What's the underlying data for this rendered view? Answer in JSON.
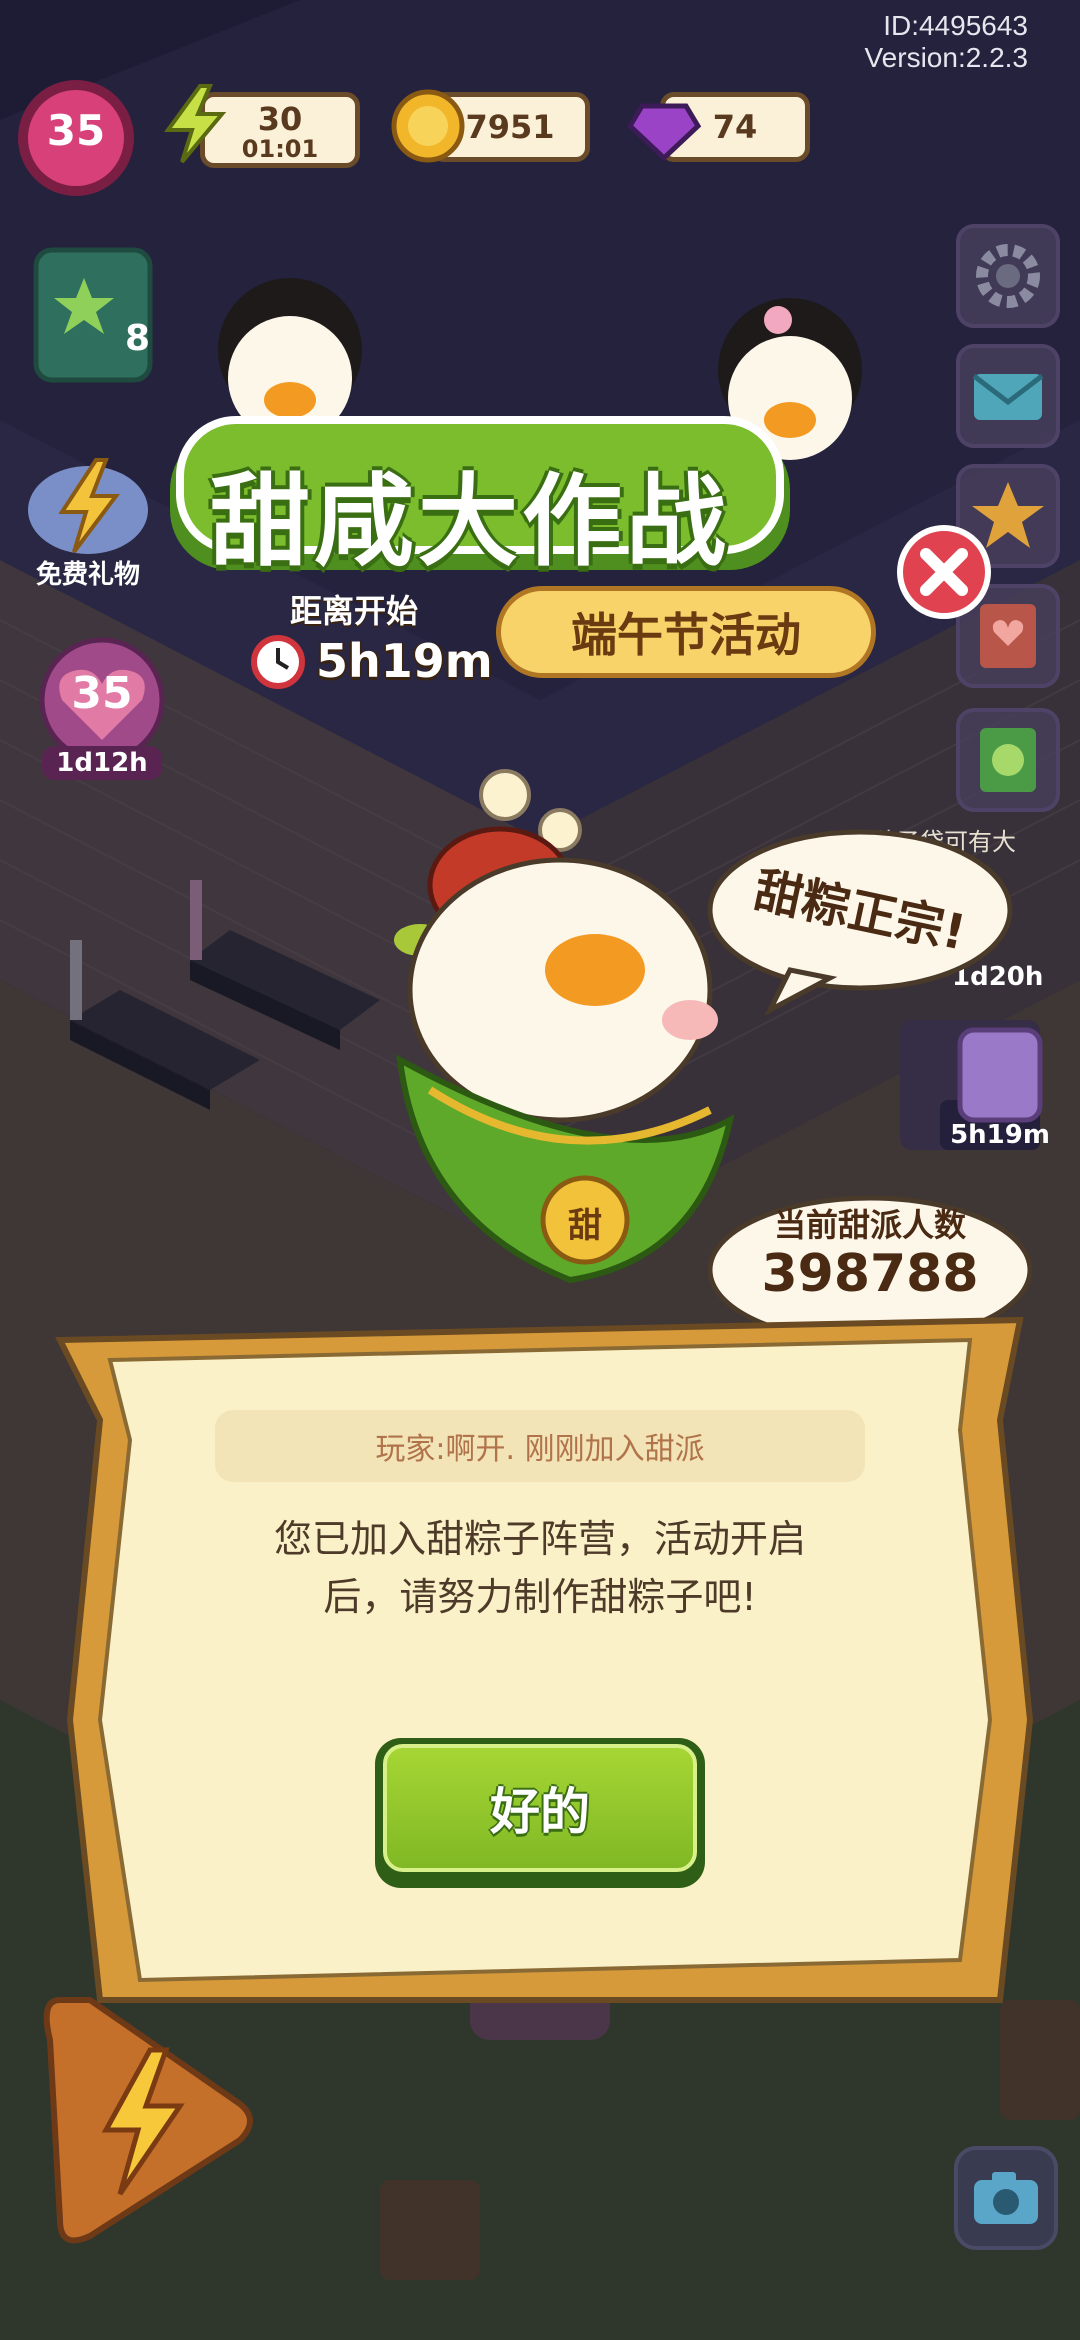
{
  "meta": {
    "id_text": "ID:4495643",
    "version_text": "Version:2.2.3"
  },
  "hud": {
    "level": "35",
    "energy_value": "30",
    "energy_timer": "01:01",
    "coins": "7951",
    "gems": "74"
  },
  "left_panel": {
    "task_count": "8",
    "free_gift_label": "免费礼物",
    "event_level": "35",
    "event_timer": "1d12h"
  },
  "right_panel": {
    "timer_a": "1d20h",
    "timer_b": "5h19m",
    "seed_bag_text": "种子袋可有大"
  },
  "event": {
    "title": "甜咸大作战",
    "subtitle": "端午节活动",
    "countdown_label": "距离开始",
    "countdown_value": "5h19m",
    "mascot_speech": "甜粽正宗!",
    "badge_char": "甜",
    "team_count_label": "当前甜派人数",
    "team_count_value": "398788"
  },
  "dialog": {
    "notice": "玩家:啊开. 刚刚加入甜派",
    "message": "您已加入甜粽子阵营，活动开启后，请努力制作甜粽子吧!",
    "ok_label": "好的"
  },
  "colors": {
    "title_green": "#7bbd2d",
    "subtitle_bg": "#f7d36a",
    "scroll_bg": "#fbf1c8",
    "button_green": "#8cc429",
    "close_red": "#e0434f"
  },
  "icons": {
    "settings": "gear-icon",
    "mail": "mail-icon",
    "rank": "star-medal-icon",
    "book": "book-icon",
    "close": "close-icon",
    "clock": "clock-icon",
    "camera": "camera-icon",
    "lightning": "lightning-icon"
  }
}
